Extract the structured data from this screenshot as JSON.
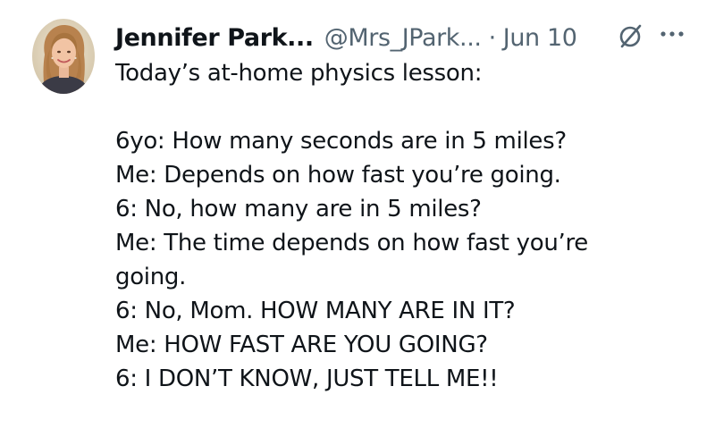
{
  "tweet": {
    "author": {
      "display_name": "Jennifer Park...",
      "handle": "@Mrs_JPark...",
      "separator": "·",
      "date": "Jun 10"
    },
    "icons": {
      "grok": "grok-slash-icon",
      "more": "more-dots-icon"
    },
    "text_lines": [
      "Today’s at-home physics lesson:",
      "",
      "6yo: How many seconds are in 5 miles?",
      "Me: Depends on how fast you’re going.",
      "6: No, how many are in 5 miles?",
      "Me: The time depends on how fast you’re",
      "going.",
      "6: No, Mom. HOW MANY ARE IN IT?",
      "Me: HOW FAST ARE YOU GOING?",
      "6: I DON’T KNOW, JUST TELL ME!!"
    ],
    "colors": {
      "primary_text": "#0f1419",
      "secondary_text": "#536471"
    }
  }
}
